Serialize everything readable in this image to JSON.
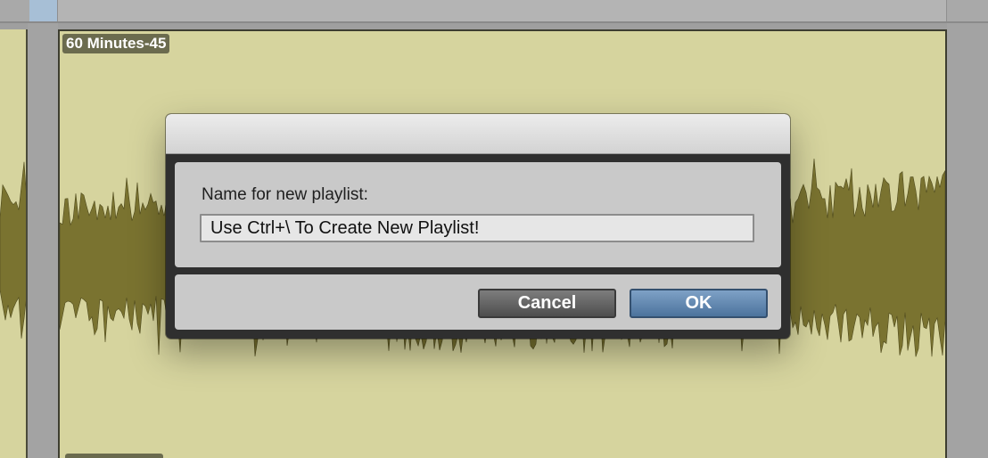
{
  "clip": {
    "name": "60 Minutes-45"
  },
  "dialog": {
    "prompt_label": "Name for new playlist:",
    "name_value": "Use Ctrl+\\ To Create New Playlist!",
    "cancel_label": "Cancel",
    "ok_label": "OK"
  },
  "colors": {
    "clip_background": "#d6d49e",
    "waveform_fill": "#7a7330",
    "ok_button": "#5a82ad",
    "cancel_button": "#5f5f5f"
  }
}
